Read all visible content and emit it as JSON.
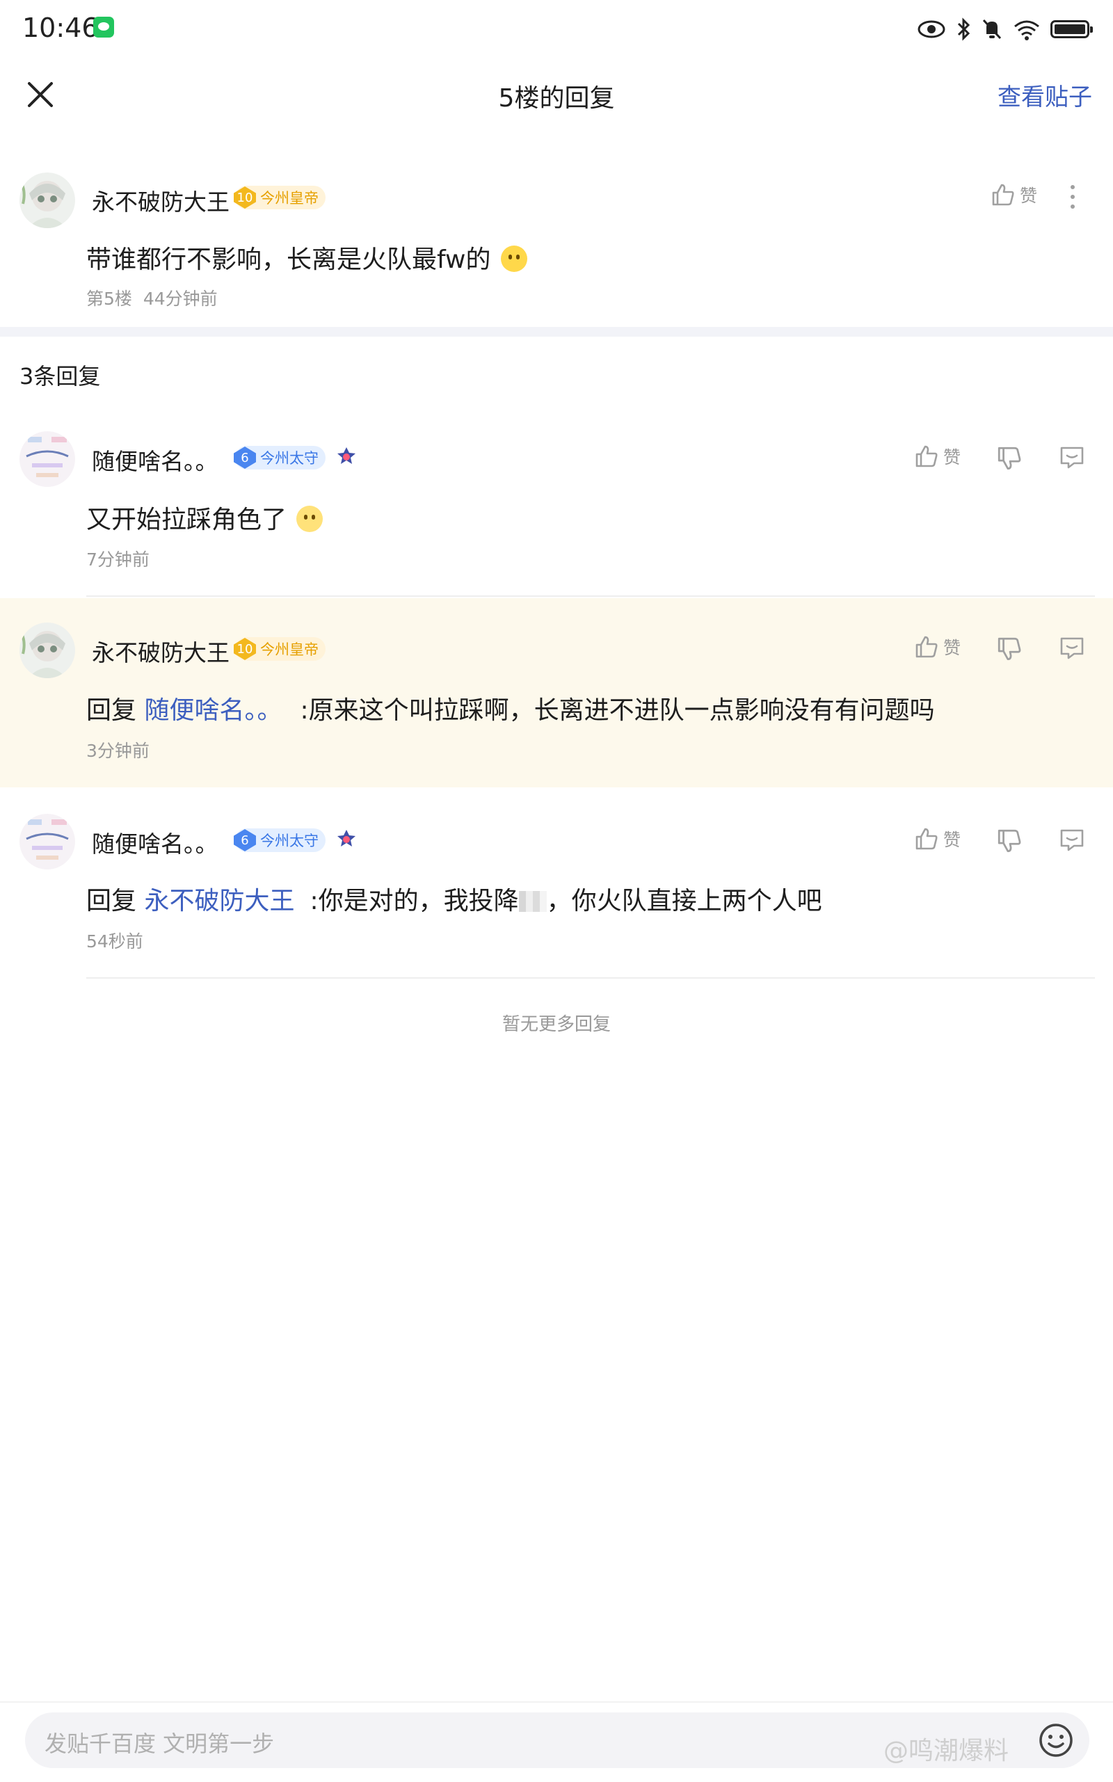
{
  "status_bar": {
    "time": "10:46"
  },
  "header": {
    "title": "5楼的回复",
    "view_post": "查看贴子"
  },
  "main_post": {
    "user": "永不破防大王",
    "badge_level": "10",
    "badge_title": "今州皇帝",
    "like_label": "赞",
    "text": "带谁都行不影响，长离是火队最fw的",
    "floor": "第5楼",
    "time": "44分钟前"
  },
  "reply_count_label": "3条回复",
  "replies": [
    {
      "user": "随便啥名。。",
      "badge_level": "6",
      "badge_title": "今州太守",
      "like_label": "赞",
      "text": "又开始拉踩角色了",
      "time": "7分钟前"
    },
    {
      "user": "永不破防大王",
      "badge_level": "10",
      "badge_title": "今州皇帝",
      "like_label": "赞",
      "reply_prefix": "回复 ",
      "reply_to": "随便啥名。。",
      "text": ":原来这个叫拉踩啊，长离进不进队一点影响没有有问题吗",
      "time": "3分钟前"
    },
    {
      "user": "随便啥名。。",
      "badge_level": "6",
      "badge_title": "今州太守",
      "like_label": "赞",
      "reply_prefix": "回复 ",
      "reply_to": "永不破防大王",
      "text_before": ":你是对的，我投降",
      "text_after": "，你火队直接上两个人吧",
      "time": "54秒前"
    }
  ],
  "no_more_label": "暂无更多回复",
  "input": {
    "placeholder": "发贴千百度 文明第一步"
  },
  "watermark": "@鸣潮爆料",
  "colors": {
    "link": "#3d5fbf",
    "highlight_bg": "#fdf9ec",
    "gold_badge": "#f3b81e",
    "blue_badge": "#4a86f0"
  }
}
